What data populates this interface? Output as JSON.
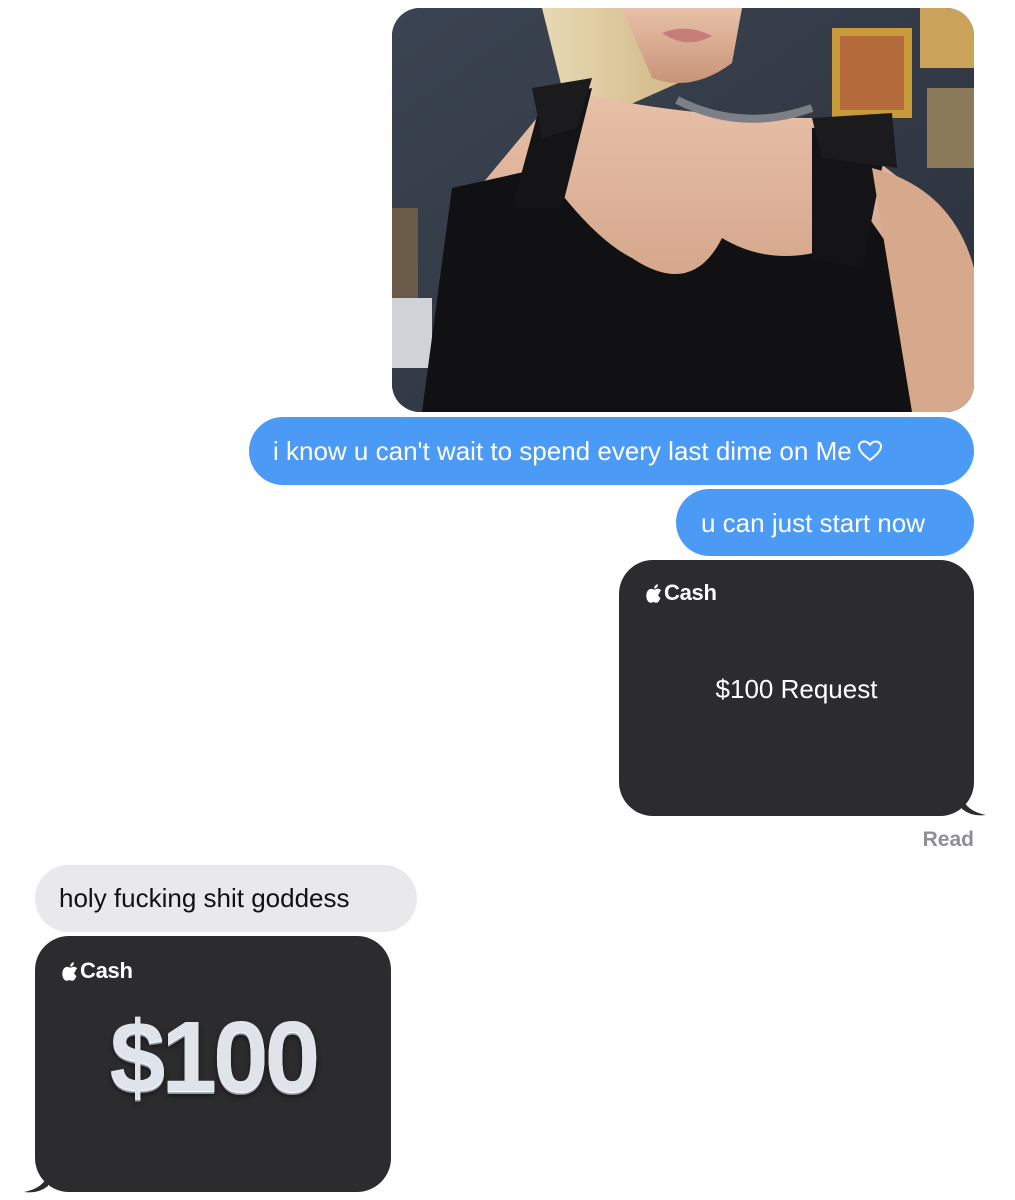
{
  "messages": {
    "outgoing_1": "i know u can't wait to spend every last dime on Me",
    "outgoing_2": "u can just start now",
    "incoming_1": "holy fucking shit goddess"
  },
  "cash_request": {
    "brand": "Cash",
    "label": "$100 Request"
  },
  "status": {
    "read": "Read"
  },
  "cash_received": {
    "brand": "Cash",
    "amount": "$100"
  },
  "colors": {
    "outgoing_bubble": "#4a9af6",
    "incoming_bubble": "#e9e9eb",
    "cash_card": "#2c2c2e"
  },
  "icons": {
    "heart": "heart-icon",
    "apple": "apple-icon"
  }
}
